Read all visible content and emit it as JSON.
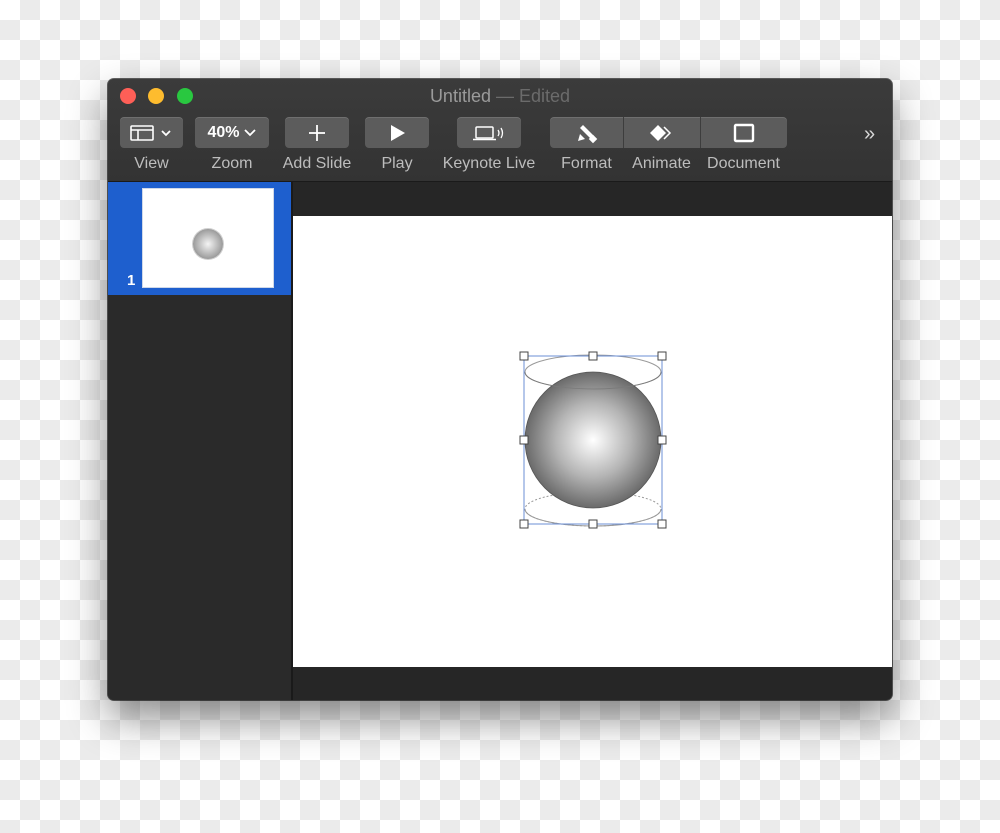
{
  "window": {
    "title": "Untitled",
    "separator": "—",
    "status": "Edited"
  },
  "toolbar": {
    "items": [
      {
        "id": "view",
        "label": "View",
        "icon": "sidebar-layout-icon"
      },
      {
        "id": "zoom",
        "label": "Zoom",
        "value": "40%"
      },
      {
        "id": "add-slide",
        "label": "Add Slide",
        "icon": "plus-icon"
      },
      {
        "id": "play",
        "label": "Play",
        "icon": "play-icon"
      },
      {
        "id": "keynote-live",
        "label": "Keynote Live",
        "icon": "laptop-broadcast-icon"
      },
      {
        "id": "format",
        "label": "Format",
        "icon": "paintbrush-icon"
      },
      {
        "id": "animate",
        "label": "Animate",
        "icon": "diamond-animate-icon"
      },
      {
        "id": "document",
        "label": "Document",
        "icon": "document-square-icon"
      }
    ],
    "overflow_icon": "double-chevron-right-icon",
    "overflow_glyph": "»"
  },
  "navigator": {
    "slides": [
      {
        "number": "1",
        "selected": true
      }
    ],
    "selection_color": "#1e5fce"
  },
  "slide": {
    "shape": "sphere",
    "selected": true,
    "selection_color": "#6b8fd6"
  }
}
